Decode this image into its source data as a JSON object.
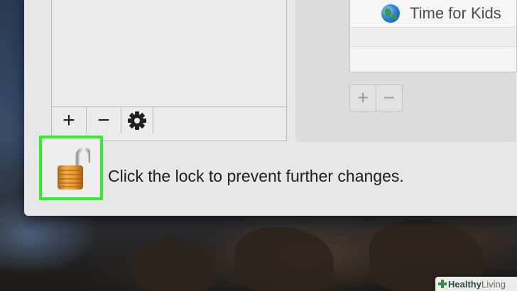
{
  "left_list": {
    "add_label": "+",
    "remove_label": "−",
    "gear_label": "⚙"
  },
  "websites": {
    "rows": [
      {
        "label": "Time for Kids",
        "icon": "globe-icon"
      }
    ],
    "add_label": "+",
    "remove_label": "−"
  },
  "lock": {
    "icon": "unlocked-padlock-icon",
    "message": "Click the lock to prevent further changes.",
    "highlight_color": "#2ef02a"
  },
  "watermark": {
    "brand_part1": "Healthy",
    "brand_part2": "Living"
  }
}
